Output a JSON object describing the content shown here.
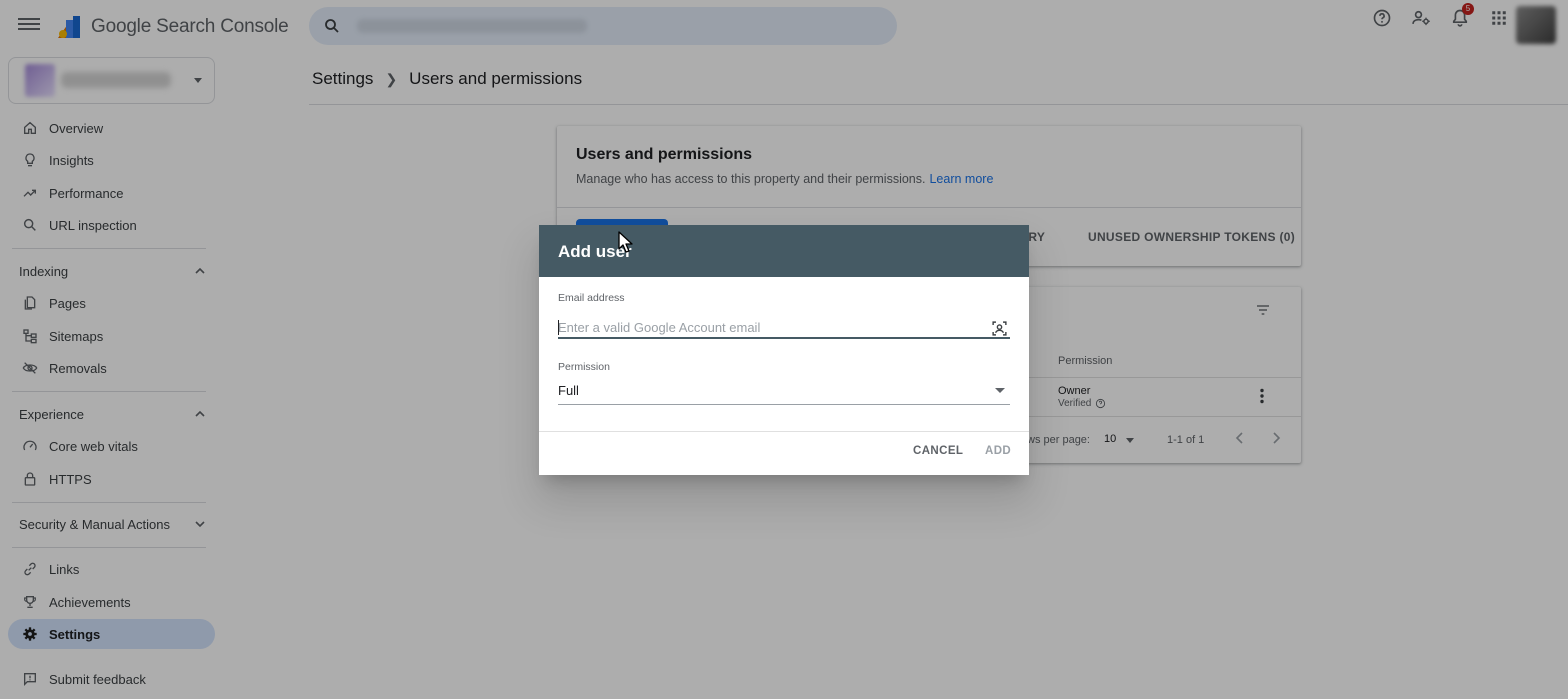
{
  "app": {
    "title": "Google Search Console"
  },
  "topbar": {
    "notification_count": "5"
  },
  "sidebar": {
    "items_top": [
      {
        "label": "Overview",
        "icon": "home-icon"
      },
      {
        "label": "Insights",
        "icon": "lightbulb-icon"
      },
      {
        "label": "Performance",
        "icon": "trending-up-icon"
      },
      {
        "label": "URL inspection",
        "icon": "search-icon"
      }
    ],
    "sections": {
      "indexing": "Indexing",
      "experience": "Experience",
      "security": "Security & Manual Actions"
    },
    "indexing_items": [
      {
        "label": "Pages",
        "icon": "pages-icon"
      },
      {
        "label": "Sitemaps",
        "icon": "sitemap-icon"
      },
      {
        "label": "Removals",
        "icon": "visibility-off-icon"
      }
    ],
    "experience_items": [
      {
        "label": "Core web vitals",
        "icon": "speed-icon"
      },
      {
        "label": "HTTPS",
        "icon": "lock-icon"
      }
    ],
    "bottom_items": [
      {
        "label": "Links",
        "icon": "link-icon"
      },
      {
        "label": "Achievements",
        "icon": "trophy-icon"
      },
      {
        "label": "Settings",
        "icon": "gear-icon",
        "active": true
      }
    ],
    "feedback": {
      "label": "Submit feedback",
      "icon": "feedback-icon"
    }
  },
  "breadcrumb": {
    "parent": "Settings",
    "current": "Users and permissions"
  },
  "main_card": {
    "title": "Users and permissions",
    "subtitle": "Manage who has access to this property and their permissions.",
    "learn_more": "Learn more",
    "tab_history": "STORY",
    "tab_tokens": "UNUSED OWNERSHIP TOKENS (0)"
  },
  "users_table": {
    "permission_header": "Permission",
    "row_permission": "Owner",
    "row_status": "Verified",
    "rows_per_page_label": "ws per page:",
    "rows_per_page_value": "10",
    "range": "1-1 of 1"
  },
  "dialog": {
    "title": "Add user",
    "email_label": "Email address",
    "email_value": "",
    "email_placeholder": "Enter a valid Google Account email",
    "permission_label": "Permission",
    "permission_value": "Full",
    "cancel_label": "CANCEL",
    "add_label": "ADD"
  },
  "colors": {
    "dialog_header": "#455a64",
    "link": "#1a73e8",
    "active_nav": "#d3e3fd"
  }
}
